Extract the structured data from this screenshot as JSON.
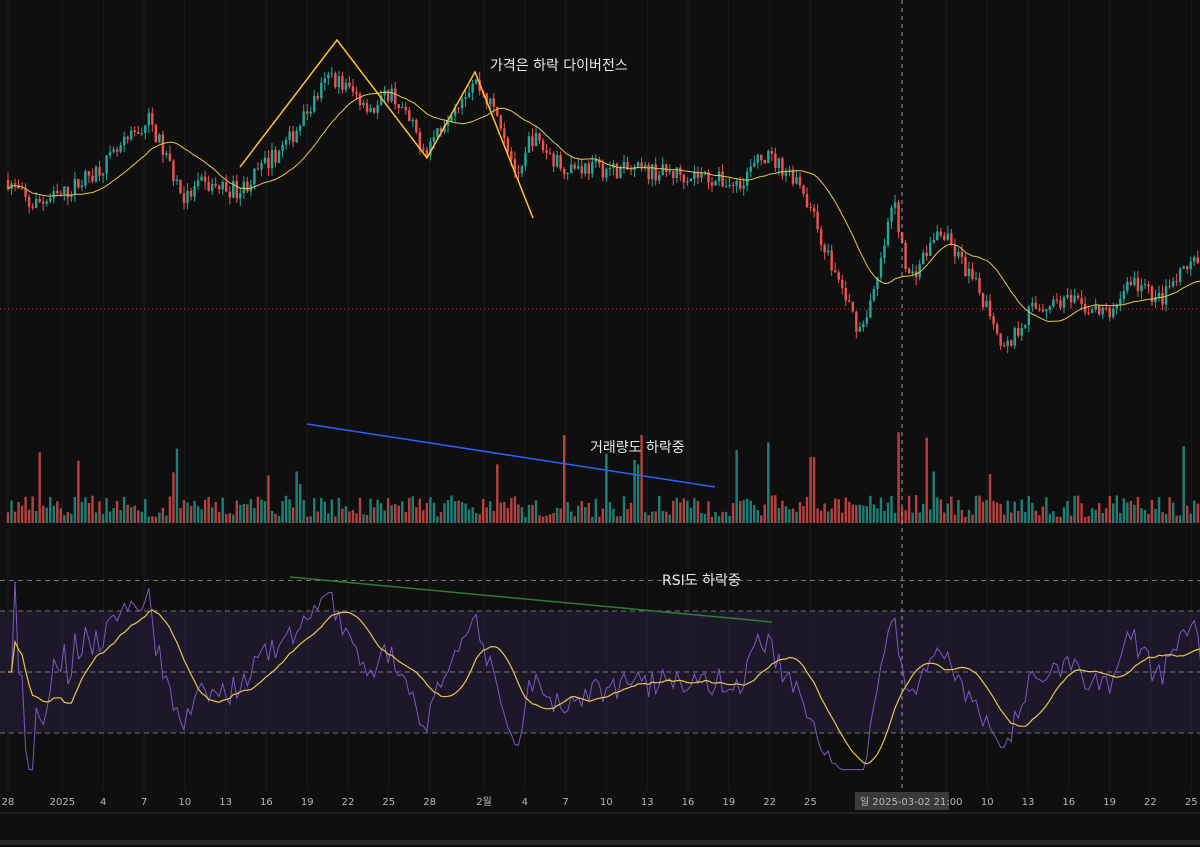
{
  "chart_data": {
    "type": "candlestick",
    "title": "",
    "note": "Price pane has no visible y-axis; values are relative price units",
    "x_ticks": [
      {
        "day": 0,
        "label": "28"
      },
      {
        "day": 4,
        "label": "2025"
      },
      {
        "day": 7,
        "label": "4"
      },
      {
        "day": 10,
        "label": "7"
      },
      {
        "day": 13,
        "label": "10"
      },
      {
        "day": 16,
        "label": "13"
      },
      {
        "day": 19,
        "label": "16"
      },
      {
        "day": 22,
        "label": "19"
      },
      {
        "day": 25,
        "label": "22"
      },
      {
        "day": 28,
        "label": "25"
      },
      {
        "day": 31,
        "label": "28"
      },
      {
        "day": 35,
        "label": "2월"
      },
      {
        "day": 38,
        "label": "4"
      },
      {
        "day": 41,
        "label": "7"
      },
      {
        "day": 44,
        "label": "10"
      },
      {
        "day": 47,
        "label": "13"
      },
      {
        "day": 50,
        "label": "16"
      },
      {
        "day": 53,
        "label": "19"
      },
      {
        "day": 56,
        "label": "22"
      },
      {
        "day": 59,
        "label": "25"
      },
      {
        "day": 69,
        "label": "7"
      },
      {
        "day": 72,
        "label": "10"
      },
      {
        "day": 75,
        "label": "13"
      },
      {
        "day": 78,
        "label": "16"
      },
      {
        "day": 81,
        "label": "19"
      },
      {
        "day": 84,
        "label": "22"
      },
      {
        "day": 87,
        "label": "25"
      }
    ],
    "crosshair": {
      "day": 65,
      "label": "일 2025-03-02   21:00"
    },
    "price_trend": {
      "x": [
        0,
        1.6,
        4,
        7.5,
        10.4,
        13,
        14.1,
        17.1,
        20.7,
        23.7,
        25.1,
        27,
        28.1,
        30.7,
        32.5,
        34.3,
        36.2,
        37.6,
        38.4,
        40.6,
        45,
        50.9,
        53.5,
        55.7,
        58.2,
        60.4,
        62.6,
        63.8,
        65.1,
        66.3,
        68.5,
        70,
        72.2,
        73.3,
        75.1,
        77.4,
        81,
        82.5,
        84.7,
        87.3,
        87.6
      ],
      "y": [
        220,
        195,
        205,
        240,
        280,
        200,
        215,
        210,
        260,
        325,
        310,
        290,
        310,
        250,
        290,
        320,
        280,
        215,
        265,
        235,
        230,
        225,
        215,
        245,
        220,
        140,
        70,
        110,
        200,
        120,
        170,
        140,
        90,
        50,
        90,
        100,
        85,
        120,
        100,
        140,
        120
      ]
    },
    "rsi": {
      "levels": [
        80,
        70,
        50,
        30
      ],
      "band": [
        30,
        70
      ],
      "ylim": [
        15,
        90
      ]
    },
    "series": [
      {
        "name": "Price candles",
        "up_color": "#26a69a",
        "down_color": "#ef5350"
      },
      {
        "name": "Price MA",
        "color": "#e6c84a"
      },
      {
        "name": "Volume"
      },
      {
        "name": "RSI",
        "color": "#7e57c2"
      },
      {
        "name": "RSI MA",
        "color": "#e6c84a"
      }
    ],
    "annotations": [
      {
        "text": "가격은 하락 다이버전스",
        "color": "#ffc233"
      },
      {
        "text": "거래량도 하락중",
        "color": "#2962ff"
      },
      {
        "text": "RSI도 하락중",
        "color": "#2e7d32"
      }
    ]
  }
}
